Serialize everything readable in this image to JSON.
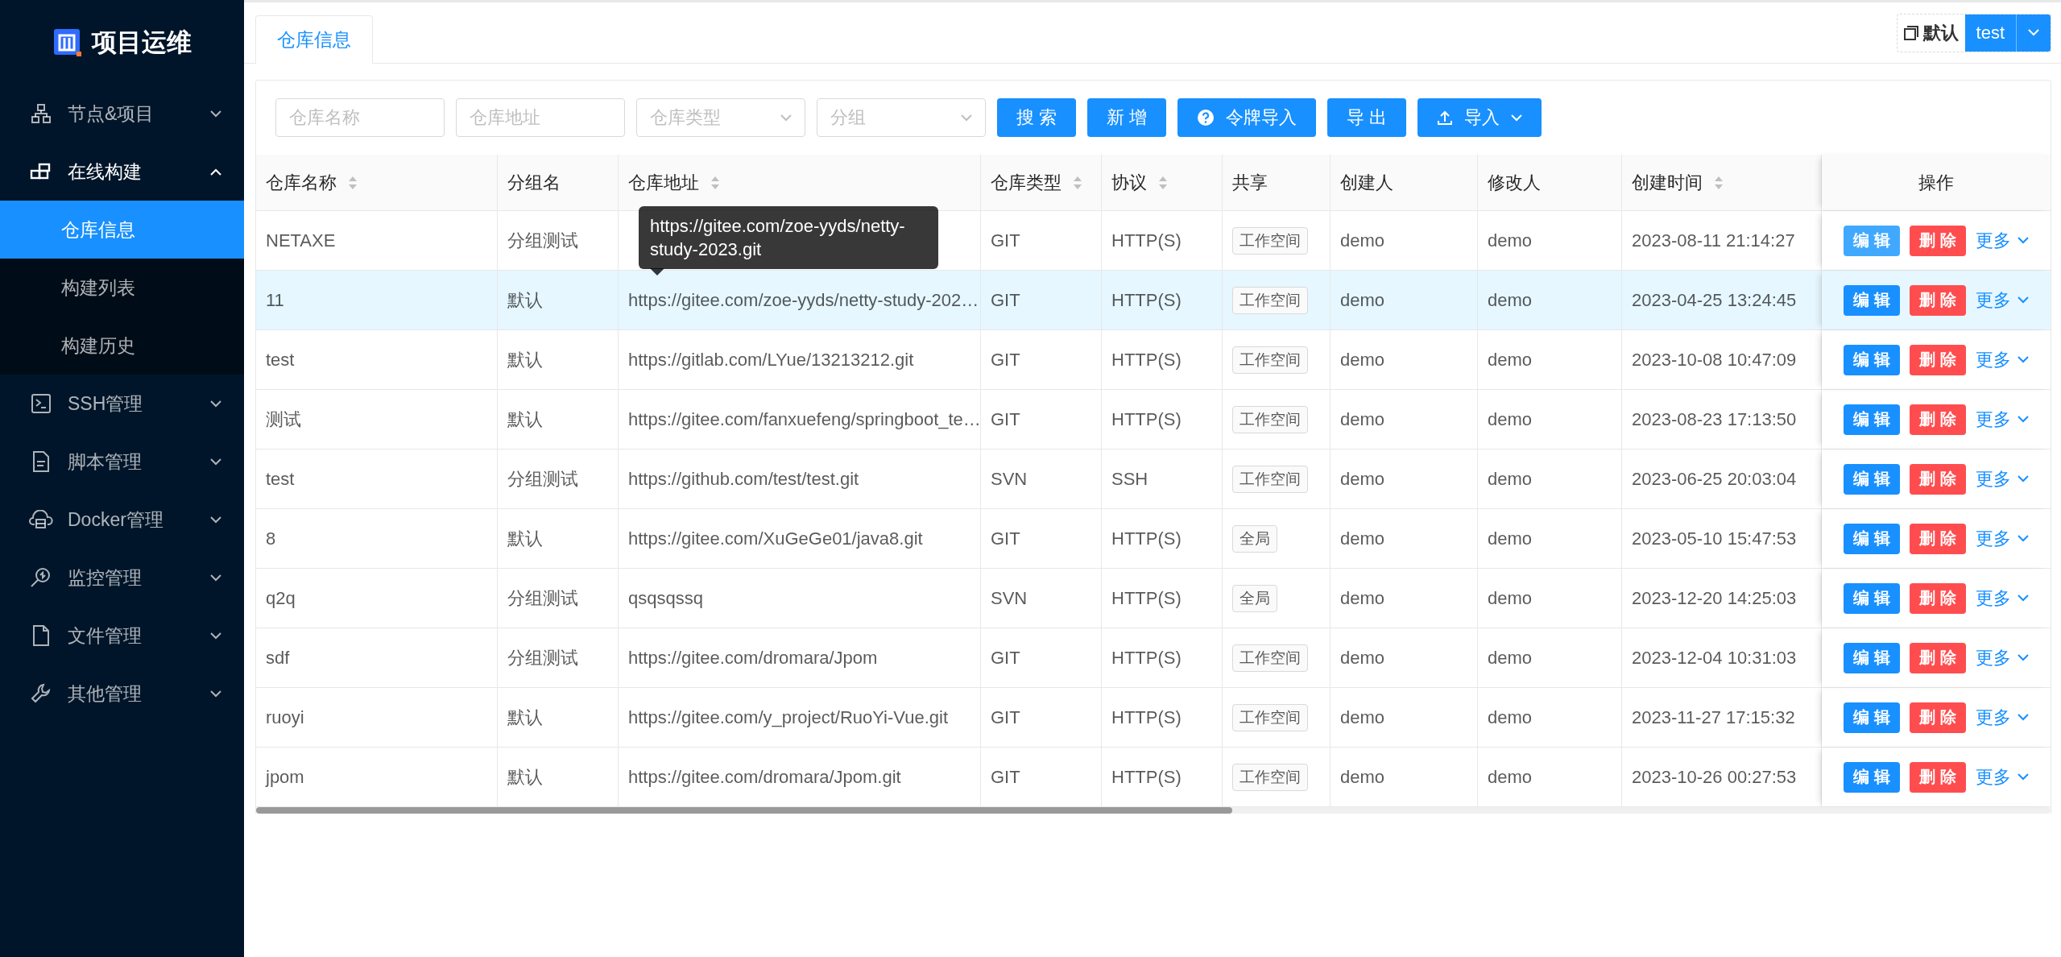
{
  "sidebar": {
    "logo": "项目运维",
    "menu": [
      {
        "label": "节点&项目",
        "expanded": false
      },
      {
        "label": "在线构建",
        "expanded": true,
        "children": [
          {
            "label": "仓库信息",
            "selected": true
          },
          {
            "label": "构建列表",
            "selected": false
          },
          {
            "label": "构建历史",
            "selected": false
          }
        ]
      },
      {
        "label": "SSH管理",
        "expanded": false
      },
      {
        "label": "脚本管理",
        "expanded": false
      },
      {
        "label": "Docker管理",
        "expanded": false
      },
      {
        "label": "监控管理",
        "expanded": false
      },
      {
        "label": "文件管理",
        "expanded": false
      },
      {
        "label": "其他管理",
        "expanded": false
      }
    ]
  },
  "tabs": [
    {
      "label": "仓库信息",
      "selected": true
    }
  ],
  "workspace": {
    "label": "默认",
    "value": "test"
  },
  "filters": [
    {
      "kind": "input",
      "placeholder": "仓库名称"
    },
    {
      "kind": "input",
      "placeholder": "仓库地址"
    },
    {
      "kind": "select",
      "placeholder": "仓库类型"
    },
    {
      "kind": "select",
      "placeholder": "分组"
    }
  ],
  "buttons": [
    {
      "kind": "plain",
      "label": "搜 索"
    },
    {
      "kind": "plain",
      "label": "新 增"
    },
    {
      "kind": "help",
      "label": "令牌导入"
    },
    {
      "kind": "plain",
      "label": "导 出"
    },
    {
      "kind": "upload",
      "label": "导入"
    }
  ],
  "table": {
    "columns": [
      {
        "label": "仓库名称",
        "sortable": true
      },
      {
        "label": "分组名",
        "sortable": false
      },
      {
        "label": "仓库地址",
        "sortable": true
      },
      {
        "label": "仓库类型",
        "sortable": true
      },
      {
        "label": "协议",
        "sortable": true
      },
      {
        "label": "共享",
        "sortable": false
      },
      {
        "label": "创建人",
        "sortable": false
      },
      {
        "label": "修改人",
        "sortable": false
      },
      {
        "label": "创建时间",
        "sortable": true
      },
      {
        "label": "操作",
        "sortable": false
      }
    ],
    "rows": [
      {
        "name": "NETAXE",
        "group": "分组测试",
        "type": "GIT",
        "protocol": "HTTP(S)",
        "share": "工作空间",
        "creator": "demo",
        "modifier": "demo",
        "created": "2023-08-11 21:14:27",
        "highlighted": false,
        "edit_hover": true,
        "edit": "编 辑",
        "delete": "删 除",
        "more": "更多"
      },
      {
        "name": "11",
        "group": "默认",
        "address": "https://gitee.com/zoe-yyds/netty-study-202…",
        "type": "GIT",
        "protocol": "HTTP(S)",
        "share": "工作空间",
        "creator": "demo",
        "modifier": "demo",
        "created": "2023-04-25 13:24:45",
        "highlighted": true,
        "edit_hover": false,
        "edit": "编 辑",
        "delete": "删 除",
        "more": "更多"
      },
      {
        "name": "test",
        "group": "默认",
        "address": "https://gitlab.com/LYue/13213212.git",
        "type": "GIT",
        "protocol": "HTTP(S)",
        "share": "工作空间",
        "creator": "demo",
        "modifier": "demo",
        "created": "2023-10-08 10:47:09",
        "highlighted": false,
        "edit_hover": false,
        "edit": "编 辑",
        "delete": "删 除",
        "more": "更多"
      },
      {
        "name": "测试",
        "group": "默认",
        "address": "https://gitee.com/fanxuefeng/springboot_te…",
        "type": "GIT",
        "protocol": "HTTP(S)",
        "share": "工作空间",
        "creator": "demo",
        "modifier": "demo",
        "created": "2023-08-23 17:13:50",
        "highlighted": false,
        "edit_hover": false,
        "edit": "编 辑",
        "delete": "删 除",
        "more": "更多"
      },
      {
        "name": "test",
        "group": "分组测试",
        "address": "https://github.com/test/test.git",
        "type": "SVN",
        "protocol": "SSH",
        "share": "工作空间",
        "creator": "demo",
        "modifier": "demo",
        "created": "2023-06-25 20:03:04",
        "highlighted": false,
        "edit_hover": false,
        "edit": "编 辑",
        "delete": "删 除",
        "more": "更多"
      },
      {
        "name": "8",
        "group": "默认",
        "address": "https://gitee.com/XuGeGe01/java8.git",
        "type": "GIT",
        "protocol": "HTTP(S)",
        "share": "全局",
        "creator": "demo",
        "modifier": "demo",
        "created": "2023-05-10 15:47:53",
        "highlighted": false,
        "edit_hover": false,
        "edit": "编 辑",
        "delete": "删 除",
        "more": "更多"
      },
      {
        "name": "q2q",
        "group": "分组测试",
        "address": "qsqsqssq",
        "type": "SVN",
        "protocol": "HTTP(S)",
        "share": "全局",
        "creator": "demo",
        "modifier": "demo",
        "created": "2023-12-20 14:25:03",
        "highlighted": false,
        "edit_hover": false,
        "edit": "编 辑",
        "delete": "删 除",
        "more": "更多"
      },
      {
        "name": "sdf",
        "group": "分组测试",
        "address": "https://gitee.com/dromara/Jpom",
        "type": "GIT",
        "protocol": "HTTP(S)",
        "share": "工作空间",
        "creator": "demo",
        "modifier": "demo",
        "created": "2023-12-04 10:31:03",
        "highlighted": false,
        "edit_hover": false,
        "edit": "编 辑",
        "delete": "删 除",
        "more": "更多"
      },
      {
        "name": "ruoyi",
        "group": "默认",
        "address": "https://gitee.com/y_project/RuoYi-Vue.git",
        "type": "GIT",
        "protocol": "HTTP(S)",
        "share": "工作空间",
        "creator": "demo",
        "modifier": "demo",
        "created": "2023-11-27 17:15:32",
        "highlighted": false,
        "edit_hover": false,
        "edit": "编 辑",
        "delete": "删 除",
        "more": "更多"
      },
      {
        "name": "jpom",
        "group": "默认",
        "address": "https://gitee.com/dromara/Jpom.git",
        "type": "GIT",
        "protocol": "HTTP(S)",
        "share": "工作空间",
        "creator": "demo",
        "modifier": "demo",
        "created": "2023-10-26 00:27:53",
        "highlighted": false,
        "edit_hover": false,
        "edit": "编 辑",
        "delete": "删 除",
        "more": "更多"
      }
    ]
  },
  "tooltip": {
    "text": "https://gitee.com/zoe-yyds/netty-study-2023.git"
  }
}
